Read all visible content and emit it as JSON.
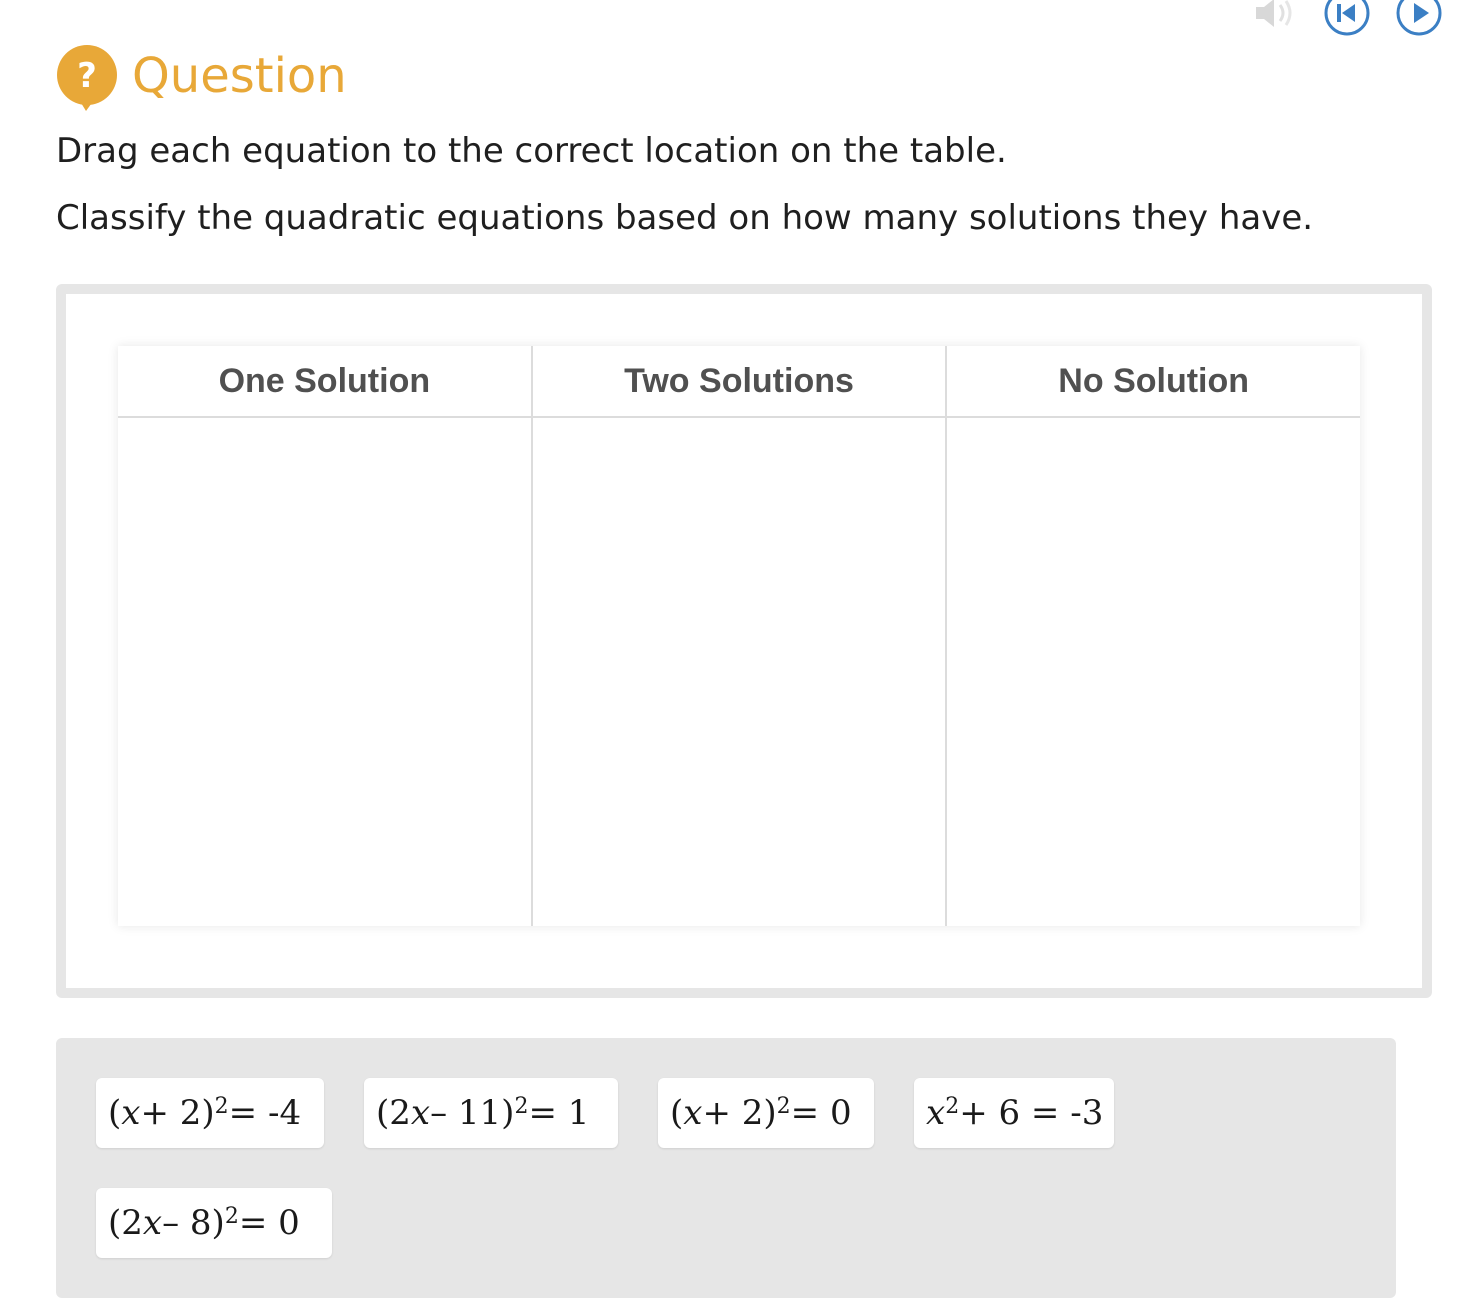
{
  "toolbar": {
    "icons": [
      "speaker-icon",
      "rewind-icon",
      "play-icon"
    ]
  },
  "header": {
    "icon": "question-bubble-icon",
    "icon_glyph": "?",
    "title": "Question"
  },
  "instructions": [
    "Drag each equation to the correct location on the table.",
    "Classify the quadratic equations based on how many solutions they have."
  ],
  "table": {
    "columns": [
      {
        "label": "One Solution"
      },
      {
        "label": "Two Solutions"
      },
      {
        "label": "No Solution"
      }
    ]
  },
  "tiles": [
    {
      "before": "(",
      "var": "x",
      "mid": " + 2)",
      "exp": "2",
      "after": " = -4"
    },
    {
      "before": "(2",
      "var": "x",
      "mid": " – 11)",
      "exp": "2",
      "after": " = 1"
    },
    {
      "before": "(",
      "var": "x",
      "mid": " + 2)",
      "exp": "2",
      "after": " = 0"
    },
    {
      "before": "",
      "var": "x",
      "mid": "",
      "exp": "2",
      "after": " + 6 = -3"
    },
    {
      "before": "(2",
      "var": "x",
      "mid": " – 8)",
      "exp": "2",
      "after": " = 0"
    }
  ],
  "colors": {
    "accent": "#e8a838",
    "toolbar_blue": "#3b7fc4",
    "bank_bg": "#e6e6e6"
  }
}
